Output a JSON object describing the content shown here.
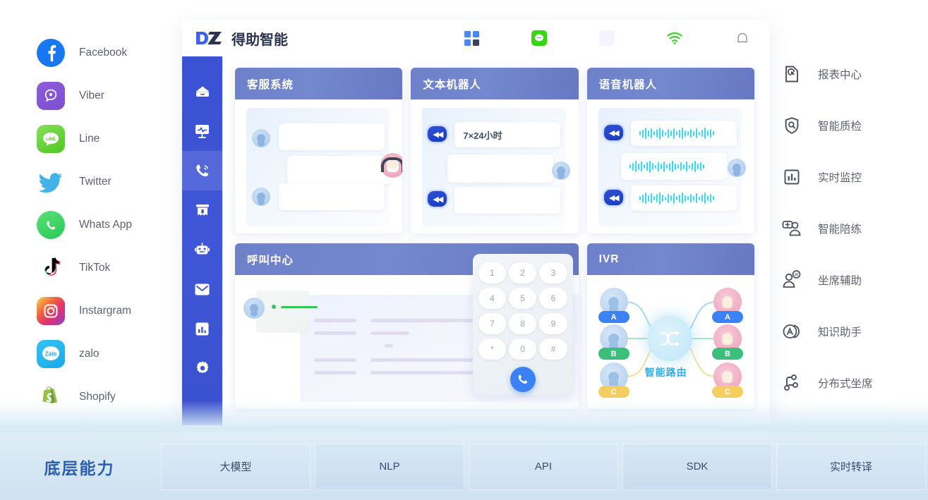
{
  "brand": {
    "mark": "DZ",
    "name": "得助智能"
  },
  "header": {
    "icons": [
      {
        "name": "apps-grid-icon"
      },
      {
        "name": "wechat-icon"
      },
      {
        "name": "placeholder-app-icon"
      },
      {
        "name": "wifi-icon"
      },
      {
        "name": "bell-icon"
      }
    ]
  },
  "social_rail": [
    {
      "label": "Facebook",
      "icon": "facebook-icon"
    },
    {
      "label": "Viber",
      "icon": "viber-icon"
    },
    {
      "label": "Line",
      "icon": "line-icon"
    },
    {
      "label": "Twitter",
      "icon": "twitter-icon"
    },
    {
      "label": "Whats App",
      "icon": "whatsapp-icon"
    },
    {
      "label": "TikTok",
      "icon": "tiktok-icon"
    },
    {
      "label": "Instargram",
      "icon": "instagram-icon"
    },
    {
      "label": "zalo",
      "icon": "zalo-icon"
    },
    {
      "label": "Shopify",
      "icon": "shopify-icon"
    }
  ],
  "feature_rail": [
    {
      "label": "报表中心",
      "icon": "report-center-icon"
    },
    {
      "label": "智能质检",
      "icon": "quality-inspection-icon"
    },
    {
      "label": "实时监控",
      "icon": "realtime-monitor-icon"
    },
    {
      "label": "智能陪练",
      "icon": "ai-coach-icon"
    },
    {
      "label": "坐席辅助",
      "icon": "agent-assist-icon"
    },
    {
      "label": "知识助手",
      "icon": "knowledge-assistant-icon"
    },
    {
      "label": "分布式坐席",
      "icon": "distributed-agent-icon"
    }
  ],
  "navbar": [
    {
      "icon": "home-icon",
      "active": false
    },
    {
      "icon": "monitor-chart-icon",
      "active": false
    },
    {
      "icon": "phone-call-icon",
      "active": true
    },
    {
      "icon": "ticket-icon",
      "active": false
    },
    {
      "icon": "robot-icon",
      "active": false
    },
    {
      "icon": "mail-icon",
      "active": false
    },
    {
      "icon": "bar-chart-icon",
      "active": false
    },
    {
      "icon": "gear-icon",
      "active": false
    }
  ],
  "cards": {
    "customer_service": {
      "title": "客服系统"
    },
    "text_bot": {
      "title": "文本机器人",
      "bubble_text": "7×24小时"
    },
    "voice_bot": {
      "title": "语音机器人"
    },
    "call_center": {
      "title": "呼叫中心",
      "keys": [
        "1",
        "2",
        "3",
        "4",
        "5",
        "6",
        "7",
        "8",
        "9",
        "*",
        "0",
        "#"
      ],
      "call_button": "call-button"
    },
    "ivr": {
      "title": "IVR",
      "route_label": "智能路由",
      "customer_tags": [
        "A",
        "B",
        "C"
      ],
      "agent_tags": [
        "A",
        "B",
        "C"
      ],
      "tag_colors": [
        "#3b82f6",
        "#3cbf7a",
        "#f5ce62"
      ]
    }
  },
  "bottom_band": {
    "title": "底层能力",
    "items": [
      "大模型",
      "NLP",
      "API",
      "SDK",
      "实时转译"
    ]
  },
  "colors": {
    "nav_blue": "#3a51d3",
    "card_header": "#6e80c9",
    "accent": "#3f63e8",
    "band_title": "#2a5fb0"
  }
}
